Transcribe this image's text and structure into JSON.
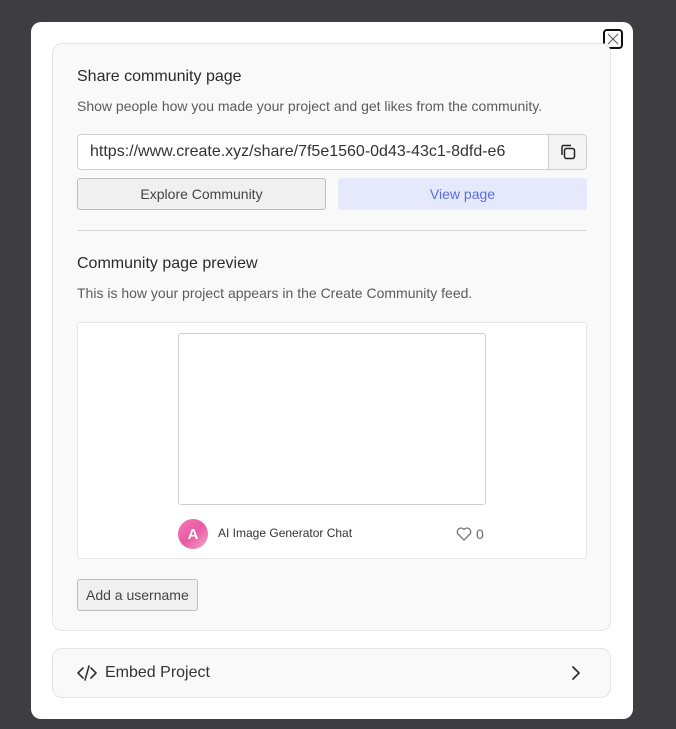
{
  "share": {
    "title": "Share community page",
    "subtitle": "Show people how you made your project and get likes from the community.",
    "url": "https://www.create.xyz/share/7f5e1560-0d43-43c1-8dfd-e6",
    "explore_label": "Explore Community",
    "view_label": "View page"
  },
  "preview": {
    "title": "Community page preview",
    "subtitle": "This is how your project appears in the Create Community feed.",
    "avatar_letter": "A",
    "project_name": "AI Image Generator Chat",
    "likes": "0"
  },
  "username_label": "Add a username",
  "embed": {
    "label": "Embed Project"
  },
  "icons": {
    "close": "close-icon",
    "copy": "copy-icon",
    "heart": "heart-icon",
    "code": "code-icon",
    "chevron": "chevron-right-icon"
  },
  "colors": {
    "backdrop": "#3e3e42",
    "accent_text": "#5a6ee0",
    "accent_bg": "#e6e9fc"
  }
}
